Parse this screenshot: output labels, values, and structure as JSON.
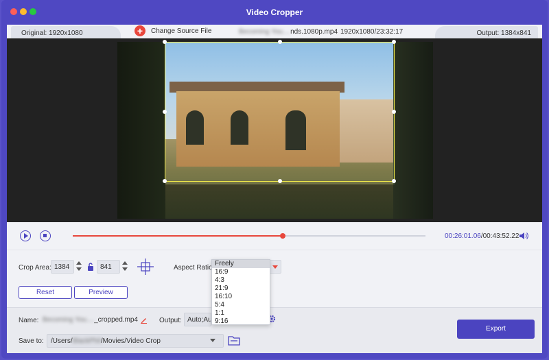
{
  "window": {
    "title": "Video Cropper"
  },
  "info_bar": {
    "original": "Original: 1920x1080",
    "change_source": "Change Source File",
    "file_name_blurred": "Becoming You....",
    "file_name_suffix": "nds.1080p.mp4",
    "file_meta": "1920x1080/23:32:17",
    "output": "Output: 1384x841"
  },
  "playback": {
    "progress_fraction": 0.595,
    "current_time": "00:26:01.06",
    "total_time": "/00:43:52.22"
  },
  "crop": {
    "area_label": "Crop Area:",
    "width": "1384",
    "height": "841",
    "aspect_label": "Aspect Ratio:",
    "reset_label": "Reset",
    "preview_label": "Preview"
  },
  "aspect_options": [
    "Freely",
    "16:9",
    "4:3",
    "21:9",
    "16:10",
    "5:4",
    "1:1",
    "9:16"
  ],
  "aspect_selected": "Freely",
  "bottom": {
    "name_label": "Name:",
    "name_blurred": "Becoming You....",
    "name_suffix": "_cropped.mp4",
    "output_label": "Output:",
    "output_value": "Auto;Auto",
    "save_label": "Save to:",
    "save_prefix": "/Users/",
    "save_blurred": "BlackPhil",
    "save_suffix": "/Movies/Video Crop",
    "export_label": "Export"
  },
  "colors": {
    "accent": "#4b44c0",
    "danger": "#e8473c",
    "crop_border": "#f4ee4a"
  }
}
